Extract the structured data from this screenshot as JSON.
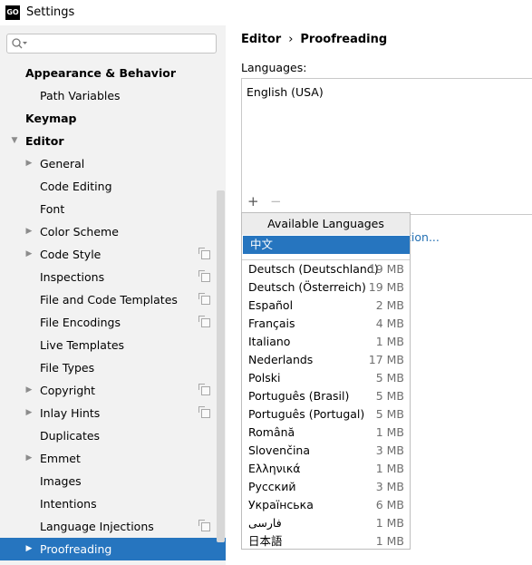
{
  "window": {
    "icon_text": "GO",
    "title": "Settings"
  },
  "sidebar": {
    "search_placeholder": "",
    "items": [
      {
        "label": "Appearance & Behavior",
        "level": 0,
        "bold": true,
        "arrow": ""
      },
      {
        "label": "Path Variables",
        "level": 1,
        "arrow": ""
      },
      {
        "label": "Keymap",
        "level": 0,
        "bold": true,
        "arrow": ""
      },
      {
        "label": "Editor",
        "level": 0,
        "bold": true,
        "arrow": "down"
      },
      {
        "label": "General",
        "level": 1,
        "arrow": "right"
      },
      {
        "label": "Code Editing",
        "level": 1,
        "arrow": ""
      },
      {
        "label": "Font",
        "level": 1,
        "arrow": ""
      },
      {
        "label": "Color Scheme",
        "level": 1,
        "arrow": "right"
      },
      {
        "label": "Code Style",
        "level": 1,
        "arrow": "right",
        "project_icon": true
      },
      {
        "label": "Inspections",
        "level": 1,
        "arrow": "",
        "project_icon": true
      },
      {
        "label": "File and Code Templates",
        "level": 1,
        "arrow": "",
        "project_icon": true
      },
      {
        "label": "File Encodings",
        "level": 1,
        "arrow": "",
        "project_icon": true
      },
      {
        "label": "Live Templates",
        "level": 1,
        "arrow": ""
      },
      {
        "label": "File Types",
        "level": 1,
        "arrow": ""
      },
      {
        "label": "Copyright",
        "level": 1,
        "arrow": "right",
        "project_icon": true
      },
      {
        "label": "Inlay Hints",
        "level": 1,
        "arrow": "right",
        "project_icon": true
      },
      {
        "label": "Duplicates",
        "level": 1,
        "arrow": ""
      },
      {
        "label": "Emmet",
        "level": 1,
        "arrow": "right"
      },
      {
        "label": "Images",
        "level": 1,
        "arrow": ""
      },
      {
        "label": "Intentions",
        "level": 1,
        "arrow": ""
      },
      {
        "label": "Language Injections",
        "level": 1,
        "arrow": "",
        "project_icon": true
      },
      {
        "label": "Proofreading",
        "level": 1,
        "arrow": "right",
        "selected": true
      }
    ]
  },
  "content": {
    "breadcrumb": {
      "parent": "Editor",
      "separator": "›",
      "current": "Proofreading"
    },
    "languages_label": "Languages:",
    "languages": [
      "English (USA)"
    ],
    "add_label": "+",
    "remove_label": "−",
    "link_fragment": "tion..."
  },
  "popup": {
    "title": "Available Languages",
    "highlighted": "中文",
    "languages": [
      {
        "name": "Deutsch (Deutschland)",
        "size": "19 MB"
      },
      {
        "name": "Deutsch (Österreich)",
        "size": "19 MB"
      },
      {
        "name": "Español",
        "size": "2 MB"
      },
      {
        "name": "Français",
        "size": "4 MB"
      },
      {
        "name": "Italiano",
        "size": "1 MB"
      },
      {
        "name": "Nederlands",
        "size": "17 MB"
      },
      {
        "name": "Polski",
        "size": "5 MB"
      },
      {
        "name": "Português (Brasil)",
        "size": "5 MB"
      },
      {
        "name": "Português (Portugal)",
        "size": "5 MB"
      },
      {
        "name": "Română",
        "size": "1 MB"
      },
      {
        "name": "Slovenčina",
        "size": "3 MB"
      },
      {
        "name": "Ελληνικά",
        "size": "1 MB"
      },
      {
        "name": "Русский",
        "size": "3 MB"
      },
      {
        "name": "Українська",
        "size": "6 MB"
      },
      {
        "name": "فارسی",
        "size": "1 MB"
      },
      {
        "name": "日本語",
        "size": "1 MB"
      }
    ]
  },
  "colors": {
    "selection": "#2675bf",
    "link": "#2470b3",
    "sidebar_bg": "#f2f2f2"
  }
}
